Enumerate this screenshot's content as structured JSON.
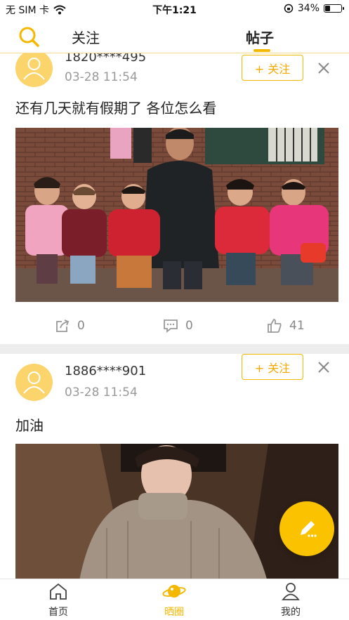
{
  "status_bar": {
    "carrier": "无 SIM 卡",
    "time": "下午1:21",
    "battery_percent": "34%",
    "battery_level": 0.34
  },
  "top_nav": {
    "tabs": [
      {
        "label": "关注"
      },
      {
        "label": "帖子"
      }
    ],
    "active_tab": "帖子"
  },
  "posts": [
    {
      "username": "1820****495",
      "time": "03-28 11:54",
      "follow_label": "+ 关注",
      "text": "还有几天就有假期了 各位怎么看",
      "share_count": "0",
      "comment_count": "0",
      "like_count": "41"
    },
    {
      "username": "1886****901",
      "time": "03-28 11:54",
      "follow_label": "+ 关注",
      "text": "加油"
    }
  ],
  "bottom_tabs": [
    {
      "label": "首页",
      "icon": "home-icon"
    },
    {
      "label": "晒圈",
      "icon": "planet-icon",
      "active": true
    },
    {
      "label": "我的",
      "icon": "profile-icon"
    }
  ],
  "colors": {
    "accent": "#f5b800",
    "avatar_bg": "#fbd46b",
    "divider": "#ededed"
  }
}
